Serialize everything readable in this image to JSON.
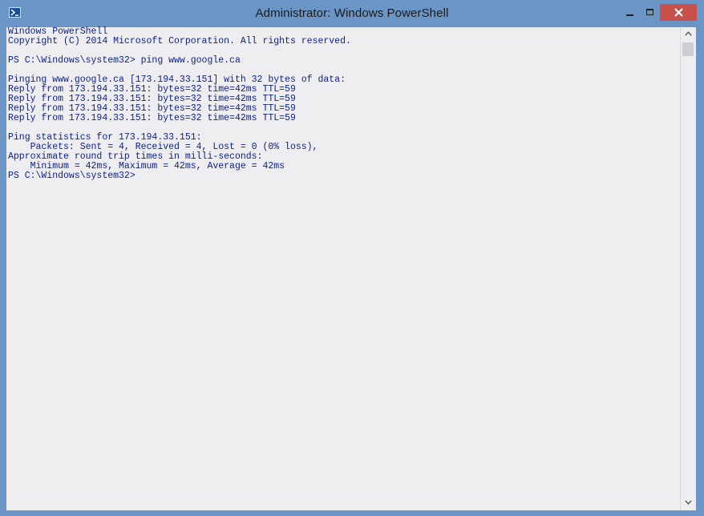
{
  "window": {
    "title": "Administrator: Windows PowerShell",
    "icon": "powershell-icon",
    "accent_color": "#6b95c4",
    "close_color": "#c7504b",
    "console_bg": "#eeedf0",
    "console_fg": "#0b1f8a"
  },
  "captions": {
    "minimize": "minimize-icon",
    "maximize": "maximize-icon",
    "close": "close-icon"
  },
  "console": {
    "lines": [
      "Windows PowerShell",
      "Copyright (C) 2014 Microsoft Corporation. All rights reserved.",
      "",
      "PS C:\\Windows\\system32> ping www.google.ca",
      "",
      "Pinging www.google.ca [173.194.33.151] with 32 bytes of data:",
      "Reply from 173.194.33.151: bytes=32 time=42ms TTL=59",
      "Reply from 173.194.33.151: bytes=32 time=42ms TTL=59",
      "Reply from 173.194.33.151: bytes=32 time=42ms TTL=59",
      "Reply from 173.194.33.151: bytes=32 time=42ms TTL=59",
      "",
      "Ping statistics for 173.194.33.151:",
      "    Packets: Sent = 4, Received = 4, Lost = 0 (0% loss),",
      "Approximate round trip times in milli-seconds:",
      "    Minimum = 42ms, Maximum = 42ms, Average = 42ms",
      "PS C:\\Windows\\system32>"
    ]
  },
  "scrollbar": {
    "up_icon": "scroll-up-arrow-icon",
    "down_icon": "scroll-down-arrow-icon",
    "position_fraction": 0.0
  }
}
